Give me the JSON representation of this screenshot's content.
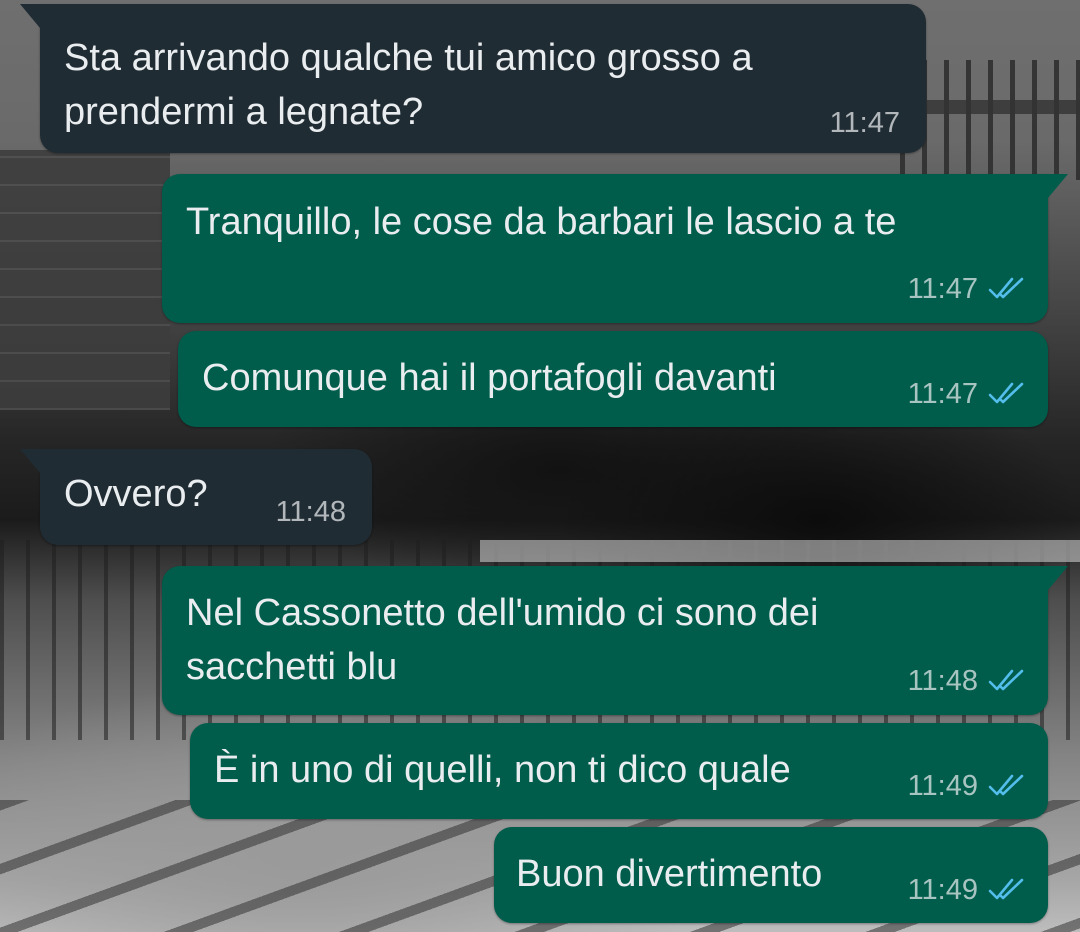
{
  "chat": {
    "messages": [
      {
        "direction": "incoming",
        "text": "Sta arrivando qualche tui amico grosso a\nprendermi a legnate?",
        "time": "11:47"
      },
      {
        "direction": "outgoing",
        "text": "Tranquillo, le cose da barbari le lascio a te",
        "time": "11:47",
        "status": "read"
      },
      {
        "direction": "outgoing",
        "text": "Comunque hai il portafogli davanti",
        "time": "11:47",
        "status": "read"
      },
      {
        "direction": "incoming",
        "text": "Ovvero?",
        "time": "11:48"
      },
      {
        "direction": "outgoing",
        "text": "Nel Cassonetto dell'umido ci sono dei\nsacchetti blu",
        "time": "11:48",
        "status": "read"
      },
      {
        "direction": "outgoing",
        "text": "È in uno di quelli, non ti dico quale",
        "time": "11:49",
        "status": "read"
      },
      {
        "direction": "outgoing",
        "text": "Buon divertimento",
        "time": "11:49",
        "status": "read"
      }
    ]
  },
  "colors": {
    "incoming_bubble": "#202c33",
    "outgoing_bubble": "#005c4b",
    "text": "#e9edef",
    "read_ticks": "#53bdeb"
  },
  "icons": {
    "read_receipt": "double-check-icon"
  }
}
